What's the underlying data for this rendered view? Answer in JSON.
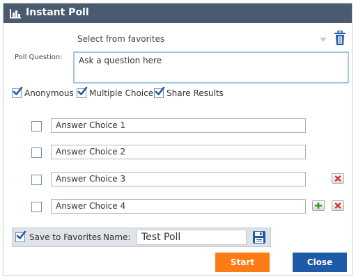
{
  "window": {
    "title": "Instant Poll"
  },
  "favorites": {
    "placeholder": "Select from favorites"
  },
  "question": {
    "label": "Poll Question:",
    "placeholder": "Ask a question here"
  },
  "options": [
    {
      "label": "Anonymous",
      "checked": true
    },
    {
      "label": "Multiple Choice",
      "checked": true
    },
    {
      "label": "Share Results",
      "checked": true
    }
  ],
  "answers": [
    {
      "text": "Answer Choice 1",
      "checked": false
    },
    {
      "text": "Answer Choice 2",
      "checked": false
    },
    {
      "text": "Answer Choice 3",
      "checked": false
    },
    {
      "text": "Answer Choice 4",
      "checked": false
    }
  ],
  "save": {
    "label": "Save to Favorites",
    "checked": true,
    "name_label": "Name:",
    "name_value": "Test Poll"
  },
  "buttons": {
    "start": "Start",
    "close": "Close"
  },
  "colors": {
    "titlebar": "#4a5b70",
    "start": "#ff7b14",
    "close": "#1e5aa8",
    "check": "#1f5aa0"
  }
}
